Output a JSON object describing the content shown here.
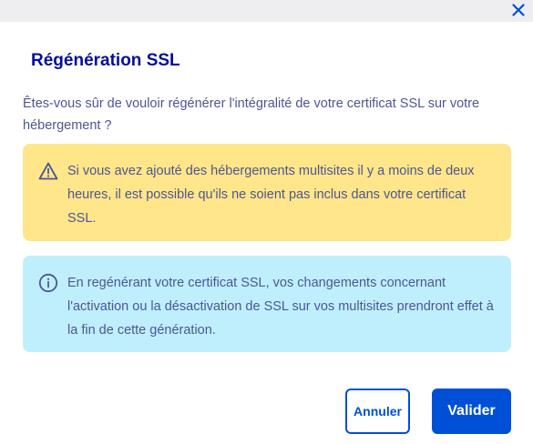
{
  "dialog": {
    "close_icon": "close-icon",
    "title": "Régénération SSL",
    "question": "Êtes-vous sûr de vouloir régénérer l'intégralité de votre certificat SSL sur votre hébergement ?",
    "warning": {
      "icon": "warning-triangle-icon",
      "text": "Si vous avez ajouté des hébergements multisites il y a moins de deux heures, il est possible qu'ils ne soient pas inclus dans votre certificat SSL."
    },
    "info": {
      "icon": "info-circle-icon",
      "text": "En regénérant votre certificat SSL, vos changements concernant l'activation ou la désactivation de SSL sur vos multisites prendront effet à la fin de cette génération."
    },
    "cancel_label": "Annuler",
    "confirm_label": "Valider"
  },
  "colors": {
    "title": "#000e9c",
    "body_text": "#4d5693",
    "warning_bg": "#ffe68a",
    "info_bg": "#bfeffd",
    "primary": "#0050d7"
  }
}
